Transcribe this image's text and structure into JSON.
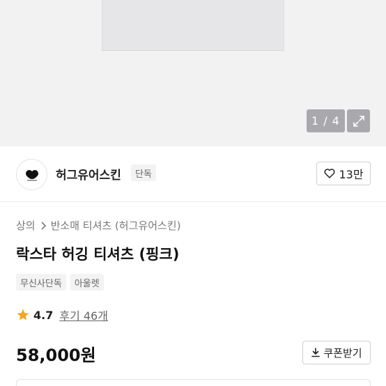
{
  "gallery": {
    "pager_text": "1 / 4",
    "expand_icon": "expand-icon"
  },
  "brand": {
    "name": "허그유어스킨",
    "badge": "단독",
    "logo_icon": "brand-logo-icon",
    "like_count": "13만",
    "like_icon": "heart-outline-icon"
  },
  "breadcrumb": {
    "root": "상의",
    "separator_icon": "chevron-right-icon",
    "current": "반소매 티셔츠 (허그유어스킨)"
  },
  "product": {
    "title": "락스타 허깅 티셔츠 (핑크)",
    "tags": [
      "무신사단독",
      "아울렛"
    ]
  },
  "rating": {
    "star_icon": "star-icon",
    "star_color": "#f5a623",
    "value": "4.7",
    "review_text": "후기 46개"
  },
  "price": {
    "amount": "58,000원",
    "coupon_label": "쿠폰받기",
    "coupon_icon": "download-icon"
  }
}
